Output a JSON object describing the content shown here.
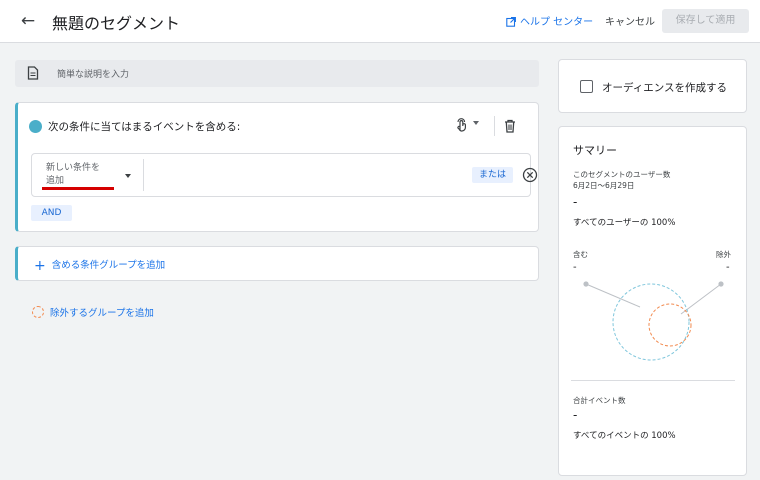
{
  "header": {
    "title": "無題のセグメント",
    "help_label": "ヘルプ センター",
    "cancel_label": "キャンセル",
    "save_label": "保存して適用"
  },
  "description": {
    "placeholder": "簡単な説明を入力"
  },
  "include_group": {
    "title": "次の条件に当てはまるイベントを含める:",
    "new_condition_label": "新しい条件を追加",
    "or_label": "または",
    "and_label": "AND"
  },
  "add_include_group_label": "含める条件グループを追加",
  "add_exclude_group_label": "除外するグループを追加",
  "audience": {
    "label": "オーディエンスを作成する",
    "checked": false
  },
  "summary": {
    "title": "サマリー",
    "users_label": "このセグメントのユーザー数",
    "date_range": "6月2日〜6月29日",
    "users_value": "-",
    "users_pct": "すべてのユーザーの 100%",
    "include_label": "含む",
    "exclude_label": "除外",
    "include_value": "-",
    "exclude_value": "-",
    "events_label": "合計イベント数",
    "events_value": "-",
    "events_pct": "すべてのイベントの 100%"
  },
  "colors": {
    "accent": "#4aaec9",
    "link": "#1a73e8",
    "exclude": "#f28b50",
    "highlight": "#d50000"
  },
  "icons": [
    "back-arrow-icon",
    "open-in-new-icon",
    "document-icon",
    "touch-icon",
    "trash-icon",
    "close-circle-icon",
    "plus-icon",
    "dashed-circle-icon",
    "checkbox-icon"
  ]
}
